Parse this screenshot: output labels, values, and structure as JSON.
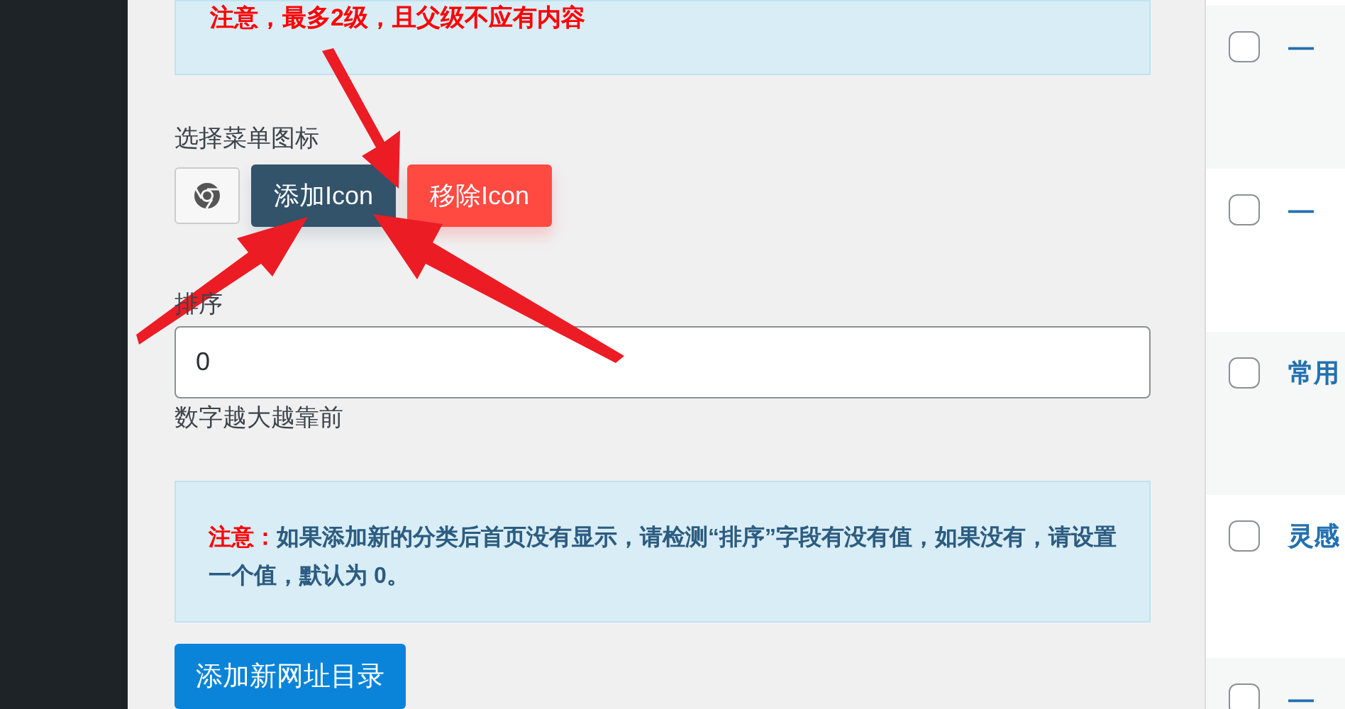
{
  "form": {
    "top_notice": "注意，最多2级，且父级不应有内容",
    "icon_label": "选择菜单图标",
    "icon_buttons": [
      {
        "kind": "preview"
      },
      {
        "kind": "add",
        "label": "添加Icon"
      },
      {
        "kind": "remove",
        "label": "移除Icon"
      }
    ],
    "order_label": "排序",
    "order_field": {
      "value": "0"
    },
    "order_help": "数字越大越靠前",
    "notice": {
      "lead": "注意：",
      "text": "如果添加新的分类后首页没有显示，请检测“排序”字段有没有值，如果没有，请设置一个值，默认为 0。"
    },
    "submit": "添加新网址目录"
  },
  "list": {
    "rows": [
      {
        "title": "—",
        "checked": false
      },
      {
        "title": "—",
        "checked": false
      },
      {
        "title": "常用",
        "checked": false
      },
      {
        "title": "灵感",
        "checked": false
      },
      {
        "title": "—",
        "checked": false
      }
    ]
  }
}
